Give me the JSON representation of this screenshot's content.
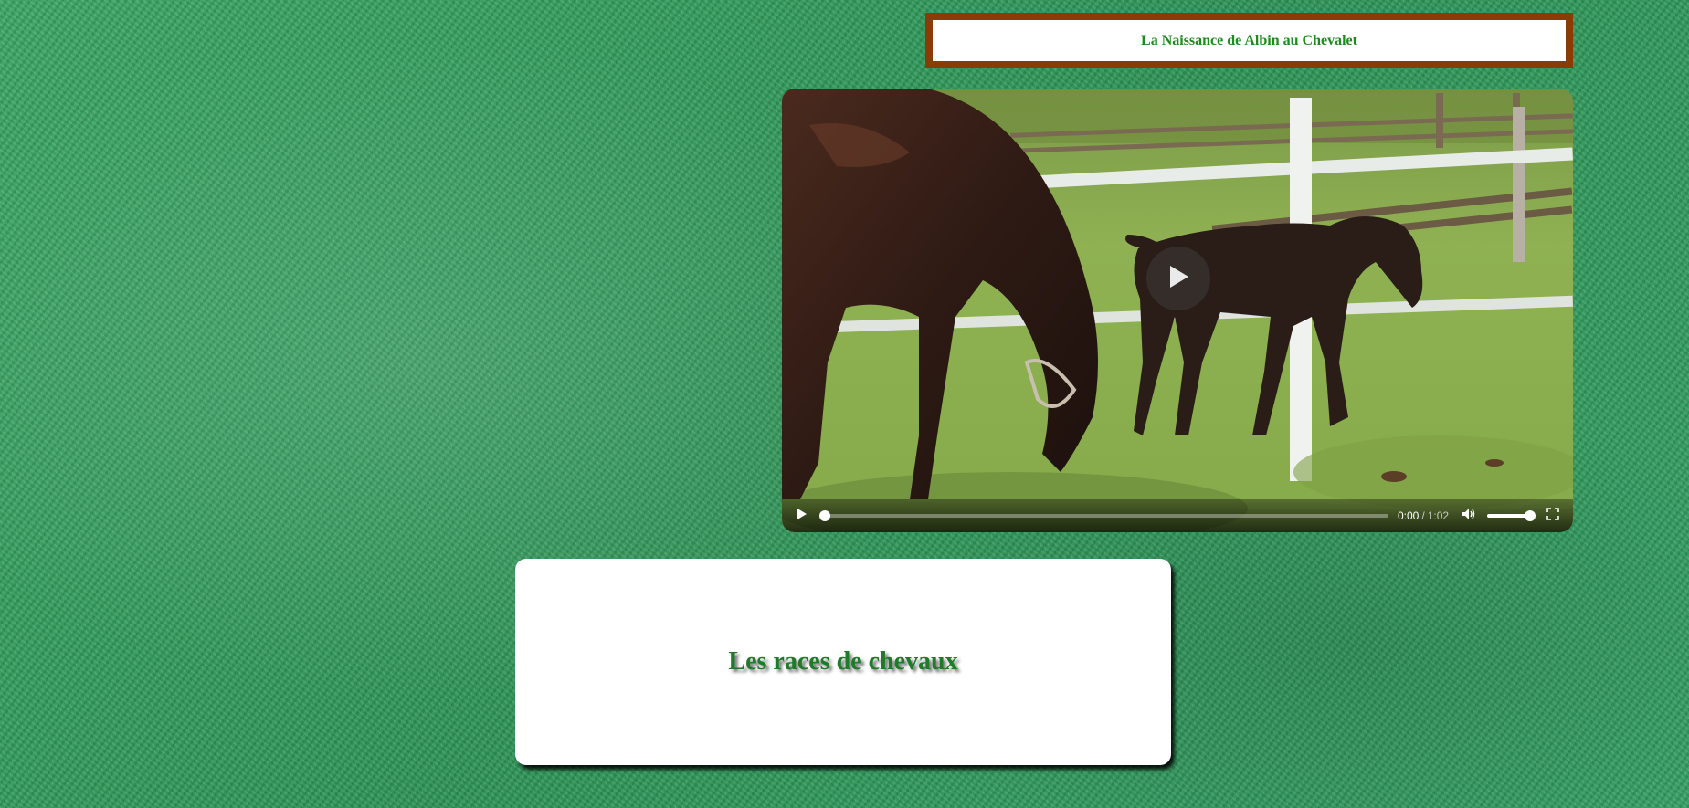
{
  "header": {
    "title": "La Naissance de Albin au Chevalet"
  },
  "video": {
    "current_time": "0:00",
    "separator": "/",
    "duration": "1:02",
    "progress_fraction": 0,
    "volume_fraction": 1,
    "play_icon": "play-icon",
    "mute_icon": "volume-icon",
    "fullscreen_icon": "fullscreen-icon"
  },
  "card": {
    "title": "Les races de chevaux"
  },
  "colors": {
    "banner_border": "#8b3b06",
    "title_text": "#1f8a1f",
    "card_title": "#1f7a2a",
    "background_grass": "#2f9a5c"
  }
}
